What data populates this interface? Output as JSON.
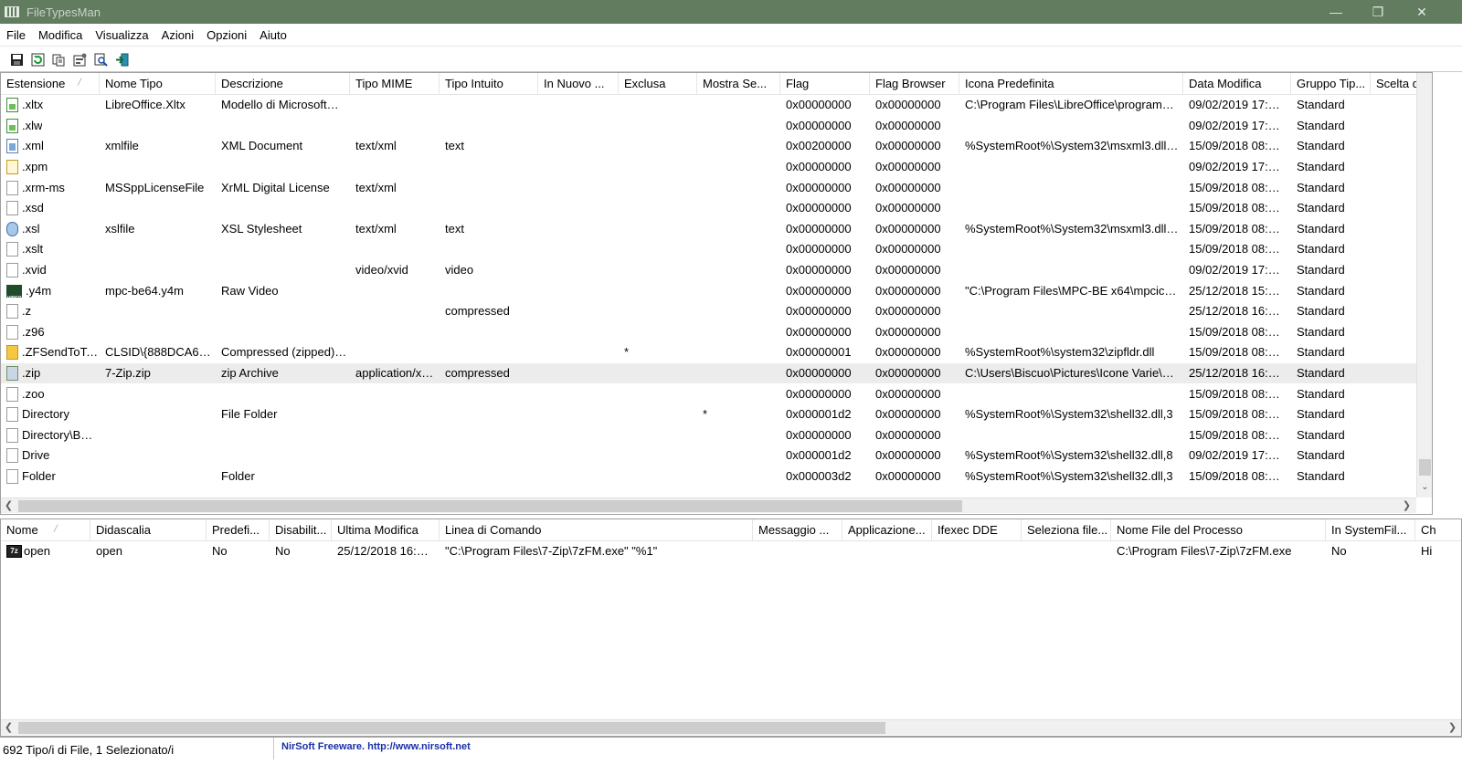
{
  "window": {
    "title": "FileTypesMan"
  },
  "menu": [
    "File",
    "Modifica",
    "Visualizza",
    "Azioni",
    "Opzioni",
    "Aiuto"
  ],
  "toolbar": {
    "icons": [
      "save-icon",
      "refresh-icon",
      "copy-icon",
      "properties-icon",
      "find-icon",
      "exit-icon"
    ]
  },
  "upper": {
    "columns": [
      "Estensione",
      "Nome Tipo",
      "Descrizione",
      "Tipo MIME",
      "Tipo Intuito",
      "In Nuovo ...",
      "Exclusa",
      "Mostra Se...",
      "Flag",
      "Flag Browser",
      "Icona Predefinita",
      "Data Modifica",
      "Gruppo Tip...",
      "Scelta d"
    ],
    "rows": [
      {
        "icon": "green",
        "cells": [
          ".xltx",
          "LibreOffice.Xltx",
          "Modello di Microsoft…",
          "",
          "",
          "",
          "",
          "",
          "0x00000000",
          "0x00000000",
          "C:\\Program Files\\LibreOffice\\program…",
          "09/02/2019 17:…",
          "Standard",
          ""
        ]
      },
      {
        "icon": "green",
        "cells": [
          ".xlw",
          "",
          "",
          "",
          "",
          "",
          "",
          "",
          "0x00000000",
          "0x00000000",
          "",
          "09/02/2019 17:…",
          "Standard",
          ""
        ]
      },
      {
        "icon": "xml",
        "cells": [
          ".xml",
          "xmlfile",
          "XML Document",
          "text/xml",
          "text",
          "",
          "",
          "",
          "0x00200000",
          "0x00000000",
          "%SystemRoot%\\System32\\msxml3.dll…",
          "15/09/2018 08:…",
          "Standard",
          ""
        ]
      },
      {
        "icon": "yellow",
        "cells": [
          ".xpm",
          "",
          "",
          "",
          "",
          "",
          "",
          "",
          "0x00000000",
          "0x00000000",
          "",
          "09/02/2019 17:…",
          "Standard",
          ""
        ]
      },
      {
        "icon": "blank",
        "cells": [
          ".xrm-ms",
          "MSSppLicenseFile",
          "XrML Digital License",
          "text/xml",
          "",
          "",
          "",
          "",
          "0x00000000",
          "0x00000000",
          "",
          "15/09/2018 08:…",
          "Standard",
          ""
        ]
      },
      {
        "icon": "blank",
        "cells": [
          ".xsd",
          "",
          "",
          "",
          "",
          "",
          "",
          "",
          "0x00000000",
          "0x00000000",
          "",
          "15/09/2018 08:…",
          "Standard",
          ""
        ]
      },
      {
        "icon": "xsl",
        "cells": [
          ".xsl",
          "xslfile",
          "XSL Stylesheet",
          "text/xml",
          "text",
          "",
          "",
          "",
          "0x00000000",
          "0x00000000",
          "%SystemRoot%\\System32\\msxml3.dll…",
          "15/09/2018 08:…",
          "Standard",
          ""
        ]
      },
      {
        "icon": "blank",
        "cells": [
          ".xslt",
          "",
          "",
          "",
          "",
          "",
          "",
          "",
          "0x00000000",
          "0x00000000",
          "",
          "15/09/2018 08:…",
          "Standard",
          ""
        ]
      },
      {
        "icon": "blank",
        "cells": [
          ".xvid",
          "",
          "",
          "video/xvid",
          "video",
          "",
          "",
          "",
          "0x00000000",
          "0x00000000",
          "",
          "09/02/2019 17:…",
          "Standard",
          ""
        ]
      },
      {
        "icon": "video",
        "cells": [
          ".y4m",
          "mpc-be64.y4m",
          "Raw Video",
          "",
          "",
          "",
          "",
          "",
          "0x00000000",
          "0x00000000",
          "\"C:\\Program Files\\MPC-BE x64\\mpcic…",
          "25/12/2018 15:…",
          "Standard",
          ""
        ]
      },
      {
        "icon": "blank",
        "cells": [
          ".z",
          "",
          "",
          "",
          "compressed",
          "",
          "",
          "",
          "0x00000000",
          "0x00000000",
          "",
          "25/12/2018 16:…",
          "Standard",
          ""
        ]
      },
      {
        "icon": "blank",
        "cells": [
          ".z96",
          "",
          "",
          "",
          "",
          "",
          "",
          "",
          "0x00000000",
          "0x00000000",
          "",
          "15/09/2018 08:…",
          "Standard",
          ""
        ]
      },
      {
        "icon": "zipf",
        "cells": [
          ".ZFSendToTa…",
          "CLSID\\{888DCA6…",
          "Compressed (zipped)…",
          "",
          "",
          "",
          "*",
          "",
          "0x00000001",
          "0x00000000",
          "%SystemRoot%\\system32\\zipfldr.dll",
          "15/09/2018 08:…",
          "Standard",
          ""
        ]
      },
      {
        "icon": "zip",
        "selected": true,
        "cells": [
          ".zip",
          "7-Zip.zip",
          "zip Archive",
          "application/x…",
          "compressed",
          "",
          "",
          "",
          "0x00000000",
          "0x00000000",
          "C:\\Users\\Biscuo\\Pictures\\Icone Varie\\…",
          "25/12/2018 16:…",
          "Standard",
          ""
        ]
      },
      {
        "icon": "blank",
        "cells": [
          ".zoo",
          "",
          "",
          "",
          "",
          "",
          "",
          "",
          "0x00000000",
          "0x00000000",
          "",
          "15/09/2018 08:…",
          "Standard",
          ""
        ]
      },
      {
        "icon": "blank",
        "cells": [
          "Directory",
          "",
          "File Folder",
          "",
          "",
          "",
          "",
          "*",
          "0x000001d2",
          "0x00000000",
          "%SystemRoot%\\System32\\shell32.dll,3",
          "15/09/2018 08:…",
          "Standard",
          ""
        ]
      },
      {
        "icon": "blank",
        "cells": [
          "Directory\\B…",
          "",
          "",
          "",
          "",
          "",
          "",
          "",
          "0x00000000",
          "0x00000000",
          "",
          "15/09/2018 08:…",
          "Standard",
          ""
        ]
      },
      {
        "icon": "blank",
        "cells": [
          "Drive",
          "",
          "",
          "",
          "",
          "",
          "",
          "",
          "0x000001d2",
          "0x00000000",
          "%SystemRoot%\\System32\\shell32.dll,8",
          "09/02/2019 17:…",
          "Standard",
          ""
        ]
      },
      {
        "icon": "blank",
        "cells": [
          "Folder",
          "",
          "Folder",
          "",
          "",
          "",
          "",
          "",
          "0x000003d2",
          "0x00000000",
          "%SystemRoot%\\System32\\shell32.dll,3",
          "15/09/2018 08:…",
          "Standard",
          ""
        ]
      }
    ]
  },
  "lower": {
    "columns": [
      "Nome",
      "Didascalia",
      "Predefi...",
      "Disabilit...",
      "Ultima Modifica",
      "Linea di Comando",
      "Messaggio ...",
      "Applicazione...",
      "Ifexec DDE",
      "Seleziona file...",
      "Nome File del Processo",
      "In SystemFil...",
      "Ch"
    ],
    "rows": [
      {
        "icon": "7z",
        "cells": [
          "open",
          "open",
          "No",
          "No",
          "25/12/2018 16:…",
          "\"C:\\Program Files\\7-Zip\\7zFM.exe\" \"%1\"",
          "",
          "",
          "",
          "",
          "C:\\Program Files\\7-Zip\\7zFM.exe",
          "No",
          "Hi"
        ]
      }
    ]
  },
  "status": {
    "count": "692 Tipo/i di File, 1 Selezionato/i",
    "credit": "NirSoft Freeware.  http://www.nirsoft.net"
  }
}
